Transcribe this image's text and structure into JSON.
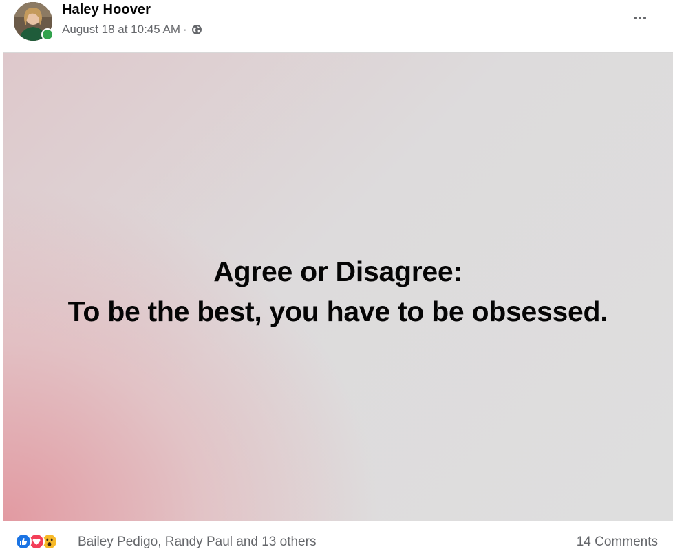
{
  "post": {
    "author": "Haley Hoover",
    "timestamp": "August 18 at 10:45 AM",
    "separator": "·",
    "privacy_icon": "globe-icon",
    "more_icon": "more-options-icon",
    "online_status_color": "#31a24c",
    "content": {
      "line1": "Agree or Disagree:",
      "line2": "To be the best, you have to be obsessed."
    },
    "reactions": {
      "icons": [
        "like-icon",
        "love-icon",
        "wow-icon"
      ],
      "summary": "Bailey Pedigo, Randy Paul and 13 others"
    },
    "comments_count": "14 Comments"
  }
}
